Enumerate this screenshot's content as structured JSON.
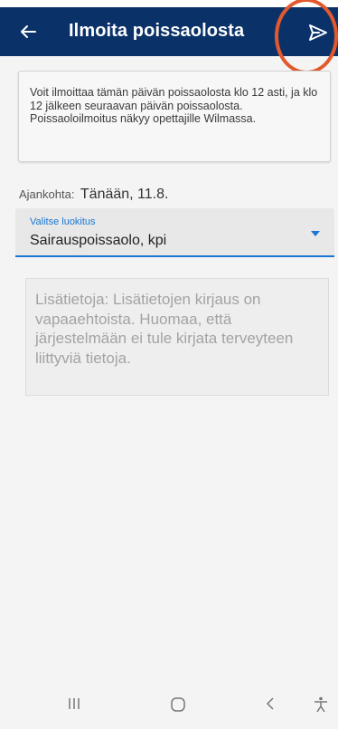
{
  "header": {
    "title": "Ilmoita poissaolosta",
    "back_icon": "arrow-left-icon",
    "send_icon": "send-icon",
    "background": "#0b3268",
    "highlight_color": "#e2592d"
  },
  "info": {
    "text": "Voit ilmoittaa tämän päivän poissaolosta klo 12 asti, ja klo 12 jälkeen seuraavan päivän poissaolosta. Poissaoloilmoitus näkyy opettajille Wilmassa."
  },
  "date": {
    "label": "Ajankohta:",
    "value": "Tänään, 11.8."
  },
  "classification": {
    "caption": "Valitse luokitus",
    "value": "Sairauspoissaolo, kpi",
    "accent": "#1976d2"
  },
  "notes": {
    "placeholder": "Lisätietoja: Lisätietojen kirjaus on vapaaehtoista. Huomaa, että järjestelmään ei tule kirjata terveyteen liittyviä tietoja."
  },
  "nav": {
    "recents_icon": "recents-icon",
    "home_icon": "home-icon",
    "back_icon": "back-chevron-icon",
    "accessibility_icon": "accessibility-icon"
  }
}
